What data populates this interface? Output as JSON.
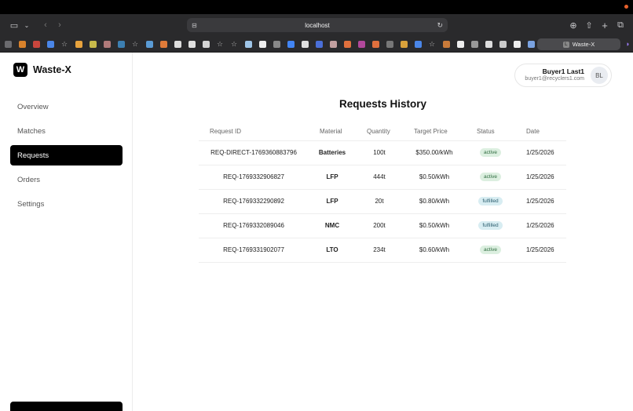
{
  "browser": {
    "url": "localhost",
    "tab_title": "Waste-X",
    "tab_favicon_letter": "L"
  },
  "app": {
    "brand_letter": "W",
    "brand_name": "Waste-X"
  },
  "nav": {
    "items": [
      {
        "label": "Overview"
      },
      {
        "label": "Matches"
      },
      {
        "label": "Requests"
      },
      {
        "label": "Orders"
      },
      {
        "label": "Settings"
      }
    ],
    "active": "Requests"
  },
  "user": {
    "name": "Buyer1 Last1",
    "email": "buyer1@recyclers1.com",
    "initials": "BL"
  },
  "page": {
    "title": "Requests History"
  },
  "table": {
    "headers": [
      "Request ID",
      "Material",
      "Quantity",
      "Target Price",
      "Status",
      "Date"
    ],
    "rows": [
      {
        "id": "REQ-DIRECT-1769360883796",
        "material": "Batteries",
        "quantity": "100t",
        "price": "$350.00/kWh",
        "status": "active",
        "date": "1/25/2026"
      },
      {
        "id": "REQ-1769332906827",
        "material": "LFP",
        "quantity": "444t",
        "price": "$0.50/kWh",
        "status": "active",
        "date": "1/25/2026"
      },
      {
        "id": "REQ-1769332290892",
        "material": "LFP",
        "quantity": "20t",
        "price": "$0.80/kWh",
        "status": "fulfilled",
        "date": "1/25/2026"
      },
      {
        "id": "REQ-1769332089046",
        "material": "NMC",
        "quantity": "200t",
        "price": "$0.50/kWh",
        "status": "fulfilled",
        "date": "1/25/2026"
      },
      {
        "id": "REQ-1769331902077",
        "material": "LTO",
        "quantity": "234t",
        "price": "$0.60/kWh",
        "status": "active",
        "date": "1/25/2026"
      }
    ]
  },
  "colors": {
    "accent": "#000000",
    "active_badge_bg": "#dcefe0",
    "fulfilled_badge_bg": "#d8edf2"
  }
}
